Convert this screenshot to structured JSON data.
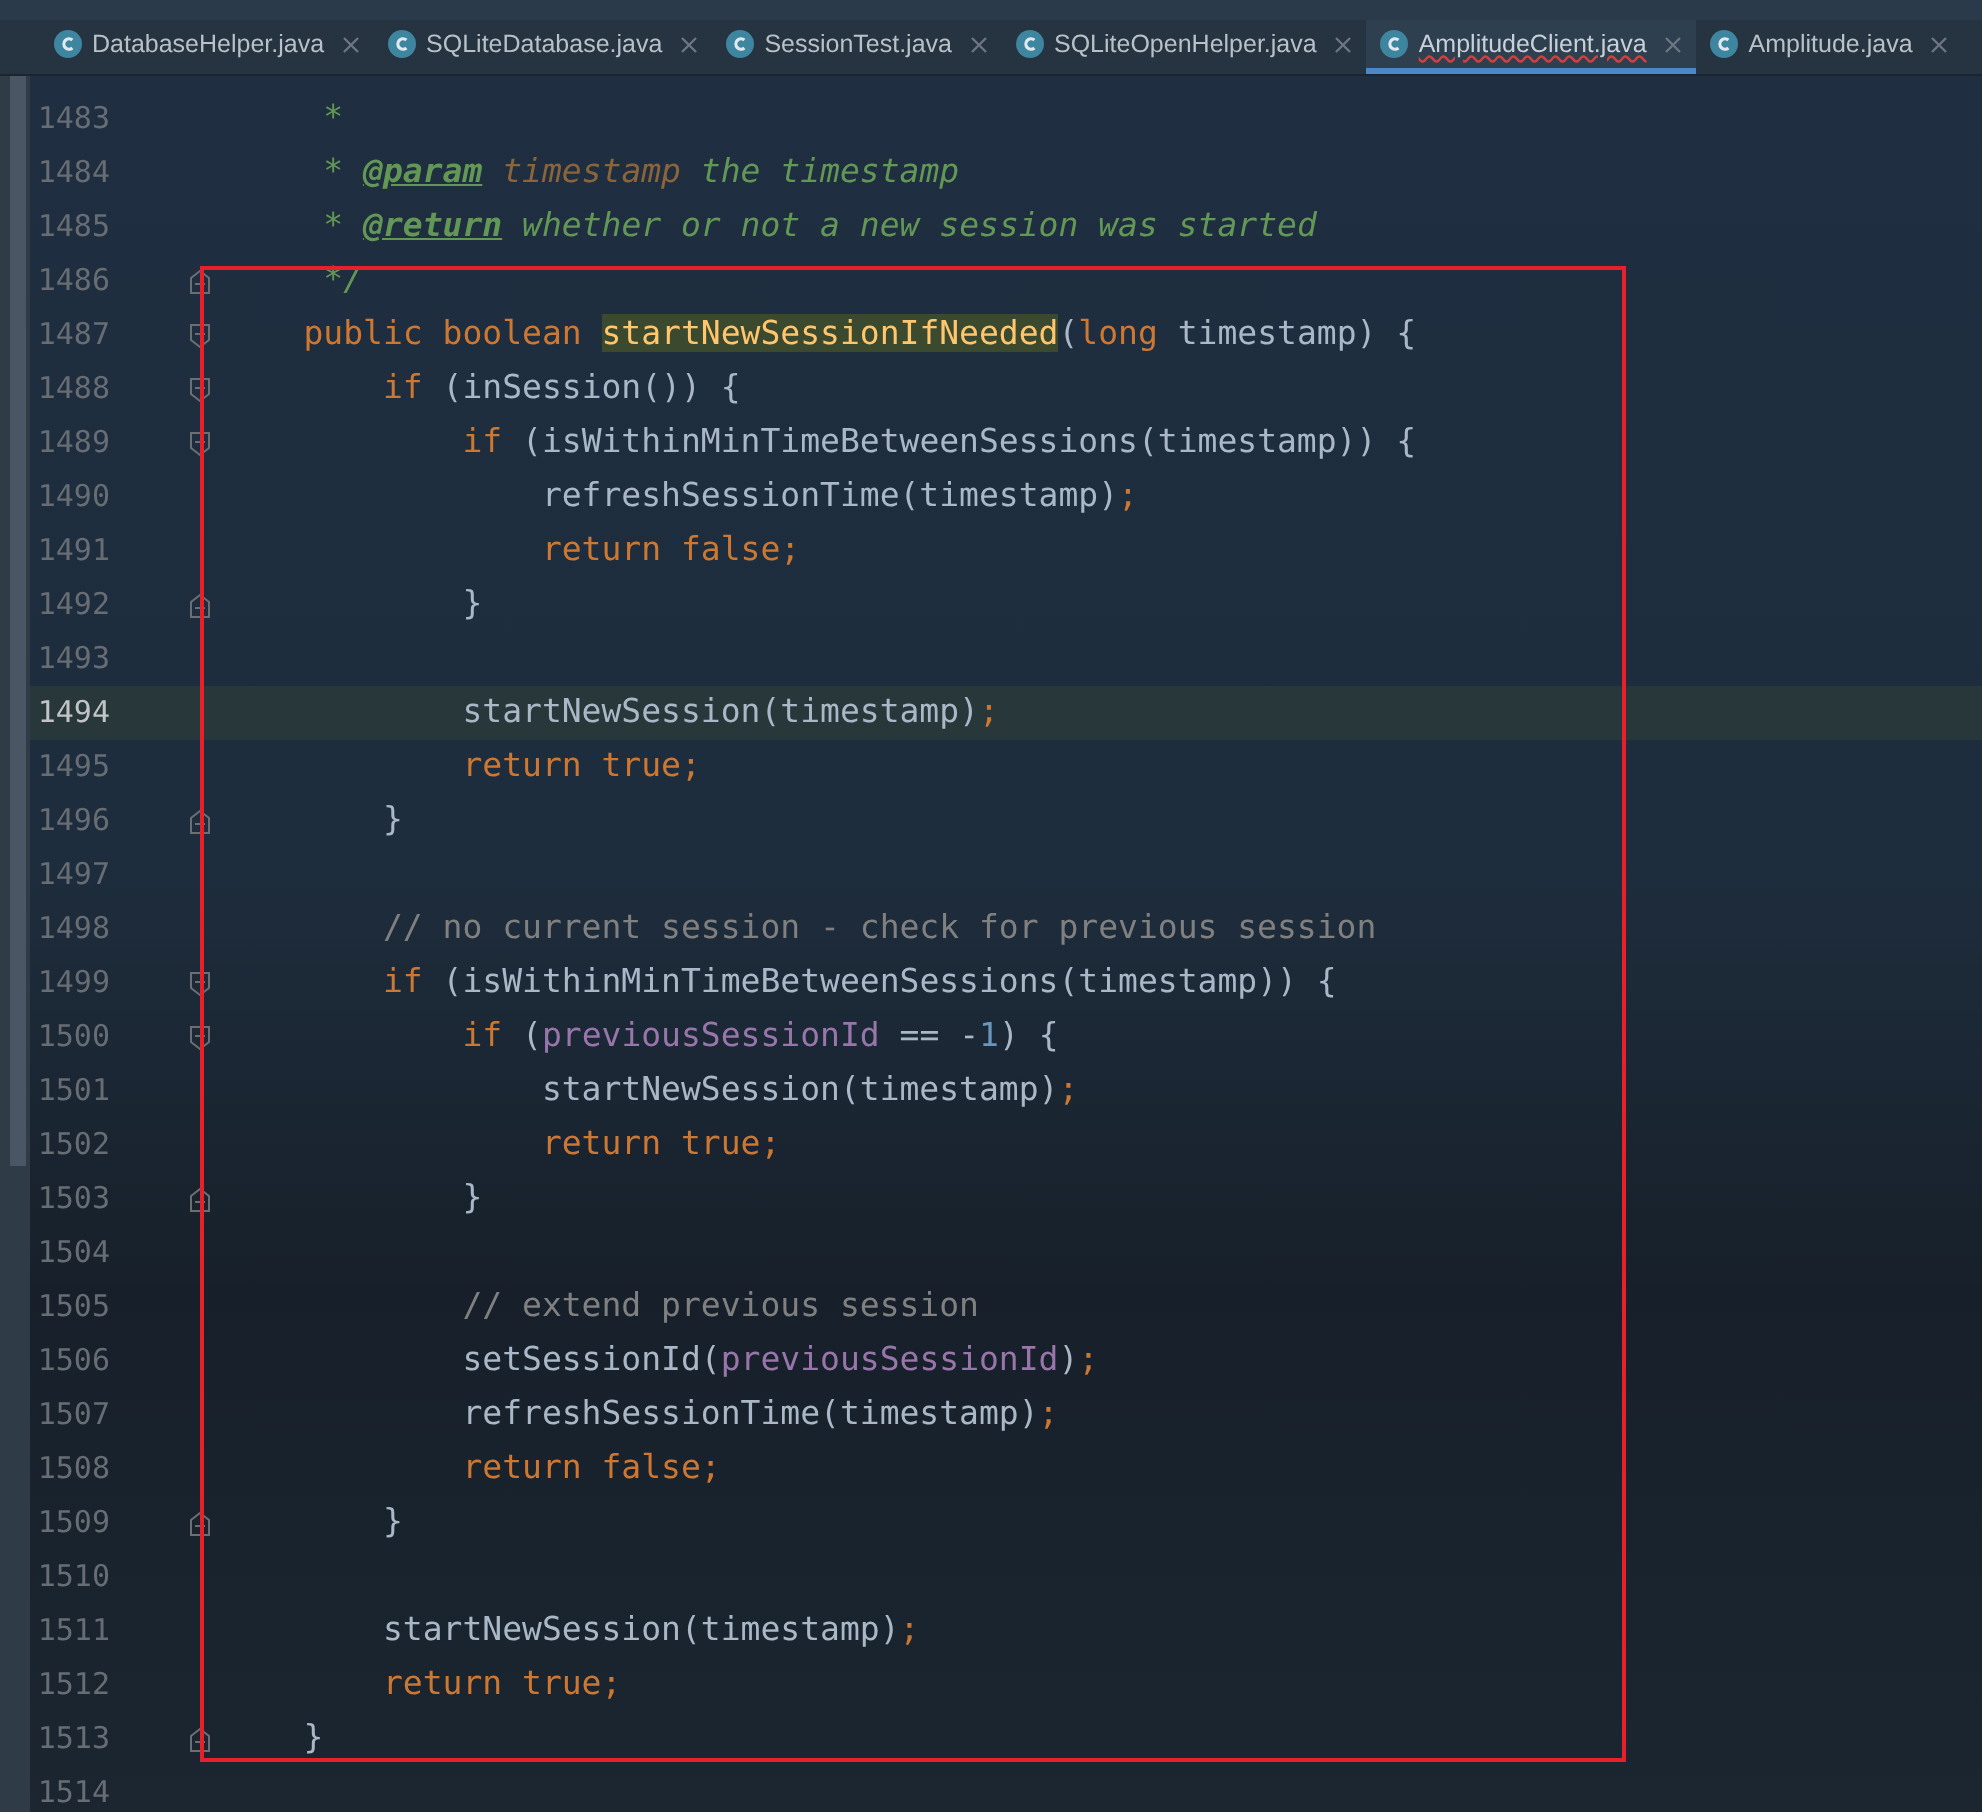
{
  "tabs": [
    {
      "label": "DatabaseHelper.java",
      "selected": false
    },
    {
      "label": "SQLiteDatabase.java",
      "selected": false
    },
    {
      "label": "SessionTest.java",
      "selected": false
    },
    {
      "label": "SQLiteOpenHelper.java",
      "selected": false
    },
    {
      "label": "AmplitudeClient.java",
      "selected": true
    },
    {
      "label": "Amplitude.java",
      "selected": false
    }
  ],
  "lines": [
    {
      "number": "1483",
      "kind": "plain",
      "current": false,
      "tokens": [
        {
          "kind": "doc",
          "text": "     *"
        }
      ]
    },
    {
      "number": "1484",
      "kind": "plain",
      "current": false,
      "tokens": [
        {
          "kind": "doc",
          "text": "     * "
        },
        {
          "kind": "doctag",
          "text": "@param"
        },
        {
          "kind": "docparam",
          "text": " timestamp"
        },
        {
          "kind": "doc",
          "text": " the timestamp"
        }
      ]
    },
    {
      "number": "1485",
      "kind": "plain",
      "current": false,
      "tokens": [
        {
          "kind": "doc",
          "text": "     * "
        },
        {
          "kind": "doctag",
          "text": "@return"
        },
        {
          "kind": "doc",
          "text": " whether or not a new session was started"
        }
      ]
    },
    {
      "number": "1486",
      "kind": "closer",
      "current": false,
      "tokens": [
        {
          "kind": "doc",
          "text": "     */"
        }
      ]
    },
    {
      "number": "1487",
      "kind": "opener",
      "current": false,
      "tokens": [
        {
          "kind": "keyword",
          "text": "    public boolean "
        },
        {
          "kind": "found",
          "text": "startNewSessionIfNeeded"
        },
        {
          "kind": "plain",
          "text": "("
        },
        {
          "kind": "keyword",
          "text": "long "
        },
        {
          "kind": "plain",
          "text": "timestamp) {"
        }
      ]
    },
    {
      "number": "1488",
      "kind": "opener",
      "current": false,
      "tokens": [
        {
          "kind": "keyword",
          "text": "        if "
        },
        {
          "kind": "plain",
          "text": "(inSession()) {"
        }
      ]
    },
    {
      "number": "1489",
      "kind": "opener",
      "current": false,
      "tokens": [
        {
          "kind": "keyword",
          "text": "            if "
        },
        {
          "kind": "plain",
          "text": "(isWithinMinTimeBetweenSessions(timestamp)) {"
        }
      ]
    },
    {
      "number": "1490",
      "kind": "plain",
      "current": false,
      "tokens": [
        {
          "kind": "plain",
          "text": "                refreshSessionTime(timestamp)"
        },
        {
          "kind": "keyword",
          "text": ";"
        }
      ]
    },
    {
      "number": "1491",
      "kind": "plain",
      "current": false,
      "tokens": [
        {
          "kind": "keyword",
          "text": "                return false;"
        }
      ]
    },
    {
      "number": "1492",
      "kind": "closer",
      "current": false,
      "tokens": [
        {
          "kind": "plain",
          "text": "            }"
        }
      ]
    },
    {
      "number": "1493",
      "kind": "plain",
      "current": false
    },
    {
      "number": "1494",
      "kind": "plain",
      "current": true,
      "tokens": [
        {
          "kind": "plain",
          "text": "            startNewSession(timestamp)"
        },
        {
          "kind": "keyword",
          "text": ";"
        }
      ]
    },
    {
      "number": "1495",
      "kind": "plain",
      "current": false,
      "tokens": [
        {
          "kind": "keyword",
          "text": "            return true;"
        }
      ]
    },
    {
      "number": "1496",
      "kind": "closer",
      "current": false,
      "tokens": [
        {
          "kind": "plain",
          "text": "        }"
        }
      ]
    },
    {
      "number": "1497",
      "kind": "plain",
      "current": false
    },
    {
      "number": "1498",
      "kind": "plain",
      "current": false,
      "tokens": [
        {
          "kind": "comment",
          "text": "        // no current session - check for previous session"
        }
      ]
    },
    {
      "number": "1499",
      "kind": "opener",
      "current": false,
      "tokens": [
        {
          "kind": "keyword",
          "text": "        if "
        },
        {
          "kind": "plain",
          "text": "(isWithinMinTimeBetweenSessions(timestamp)) {"
        }
      ]
    },
    {
      "number": "1500",
      "kind": "opener",
      "current": false,
      "tokens": [
        {
          "kind": "keyword",
          "text": "            if "
        },
        {
          "kind": "plain",
          "text": "("
        },
        {
          "kind": "field",
          "text": "previousSessionId"
        },
        {
          "kind": "plain",
          "text": " == -"
        },
        {
          "kind": "number",
          "text": "1"
        },
        {
          "kind": "plain",
          "text": ") {"
        }
      ]
    },
    {
      "number": "1501",
      "kind": "plain",
      "current": false,
      "tokens": [
        {
          "kind": "plain",
          "text": "                startNewSession(timestamp)"
        },
        {
          "kind": "keyword",
          "text": ";"
        }
      ]
    },
    {
      "number": "1502",
      "kind": "plain",
      "current": false,
      "tokens": [
        {
          "kind": "keyword",
          "text": "                return true;"
        }
      ]
    },
    {
      "number": "1503",
      "kind": "closer",
      "current": false,
      "tokens": [
        {
          "kind": "plain",
          "text": "            }"
        }
      ]
    },
    {
      "number": "1504",
      "kind": "plain",
      "current": false
    },
    {
      "number": "1505",
      "kind": "plain",
      "current": false,
      "tokens": [
        {
          "kind": "comment",
          "text": "            // extend previous session"
        }
      ]
    },
    {
      "number": "1506",
      "kind": "plain",
      "current": false,
      "tokens": [
        {
          "kind": "plain",
          "text": "            setSessionId("
        },
        {
          "kind": "field",
          "text": "previousSessionId"
        },
        {
          "kind": "plain",
          "text": ")"
        },
        {
          "kind": "keyword",
          "text": ";"
        }
      ]
    },
    {
      "number": "1507",
      "kind": "plain",
      "current": false,
      "tokens": [
        {
          "kind": "plain",
          "text": "            refreshSessionTime(timestamp)"
        },
        {
          "kind": "keyword",
          "text": ";"
        }
      ]
    },
    {
      "number": "1508",
      "kind": "plain",
      "current": false,
      "tokens": [
        {
          "kind": "keyword",
          "text": "            return false;"
        }
      ]
    },
    {
      "number": "1509",
      "kind": "closer",
      "current": false,
      "tokens": [
        {
          "kind": "plain",
          "text": "        }"
        }
      ]
    },
    {
      "number": "1510",
      "kind": "plain",
      "current": false
    },
    {
      "number": "1511",
      "kind": "plain",
      "current": false,
      "tokens": [
        {
          "kind": "plain",
          "text": "        startNewSession(timestamp)"
        },
        {
          "kind": "keyword",
          "text": ";"
        }
      ]
    },
    {
      "number": "1512",
      "kind": "plain",
      "current": false,
      "tokens": [
        {
          "kind": "keyword",
          "text": "        return true;"
        }
      ]
    },
    {
      "number": "1513",
      "kind": "closer",
      "current": false,
      "tokens": [
        {
          "kind": "plain",
          "text": "    }"
        }
      ]
    },
    {
      "number": "1514",
      "kind": "plain",
      "current": false
    }
  ]
}
